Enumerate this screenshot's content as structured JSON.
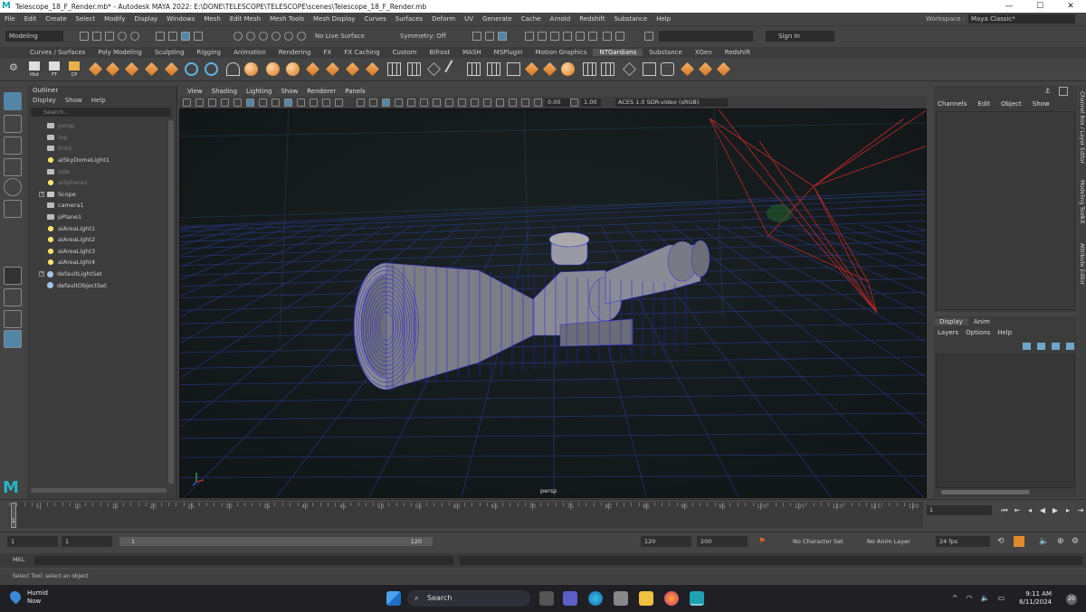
{
  "window": {
    "title": "Telescope_18_F_Render.mb* - Autodesk MAYA 2022: E:\\DONE\\TELESCOPE\\TELESCOPE\\scenes\\Telescope_18_F_Render.mb",
    "buttons": [
      "—",
      "☐",
      "✕"
    ]
  },
  "menubar": {
    "items": [
      "File",
      "Edit",
      "Create",
      "Select",
      "Modify",
      "Display",
      "Windows",
      "Mesh",
      "Edit Mesh",
      "Mesh Tools",
      "Mesh Display",
      "Curves",
      "Surfaces",
      "Deform",
      "UV",
      "Generate",
      "Cache",
      "Arnold",
      "Redshift",
      "Substance",
      "Help"
    ],
    "workspace_label": "Workspace :",
    "workspace_value": "Maya Classic*"
  },
  "statusline": {
    "mode": "Modeling",
    "live_surface": "No Live Surface",
    "symmetry": "Symmetry: Off",
    "sign_in": "Sign In"
  },
  "shelf": {
    "tabs": [
      "Curves / Surfaces",
      "Poly Modeling",
      "Sculpting",
      "Rigging",
      "Animation",
      "Rendering",
      "FX",
      "FX Caching",
      "Custom",
      "Bifrost",
      "MASH",
      "MSPlugin",
      "Motion Graphics",
      "NTGardians",
      "Substance",
      "XGen",
      "Redshift"
    ],
    "active_tab": "NTGardians",
    "small_labels": [
      "Hist",
      "FT",
      "CP"
    ]
  },
  "outliner": {
    "title": "Outliner",
    "menu": [
      "Display",
      "Show",
      "Help"
    ],
    "search_placeholder": "Search...",
    "items": [
      {
        "label": "persp",
        "icon": "camera-icon",
        "dim": true
      },
      {
        "label": "top",
        "icon": "camera-icon",
        "dim": true
      },
      {
        "label": "front",
        "icon": "camera-icon",
        "dim": true
      },
      {
        "label": "aiSkyDomeLight1",
        "icon": "light-icon",
        "dim": false
      },
      {
        "label": "side",
        "icon": "camera-icon",
        "dim": true
      },
      {
        "label": "aiSphere1",
        "icon": "light-icon",
        "dim": true
      },
      {
        "label": "Scope",
        "icon": "group-icon",
        "dim": false,
        "expandable": true
      },
      {
        "label": "camera1",
        "icon": "camera-icon",
        "dim": false
      },
      {
        "label": "pPlane1",
        "icon": "mesh-icon",
        "dim": false
      },
      {
        "label": "aiAreaLight1",
        "icon": "light-icon",
        "dim": false
      },
      {
        "label": "aiAreaLight2",
        "icon": "light-icon",
        "dim": false
      },
      {
        "label": "aiAreaLight3",
        "icon": "light-icon",
        "dim": false
      },
      {
        "label": "aiAreaLight4",
        "icon": "light-icon",
        "dim": false
      },
      {
        "label": "defaultLightSet",
        "icon": "set-icon",
        "dim": false,
        "expandable": true
      },
      {
        "label": "defaultObjectSet",
        "icon": "set-icon",
        "dim": false
      }
    ]
  },
  "viewport": {
    "menu": [
      "View",
      "Shading",
      "Lighting",
      "Show",
      "Renderer",
      "Panels"
    ],
    "exposure": "0.00",
    "gamma": "1.00",
    "color_space": "ACES 1.0 SDR-video (sRGB)",
    "camera_label": "persp"
  },
  "channelbox": {
    "menu": [
      "Channels",
      "Edit",
      "Object",
      "Show"
    ]
  },
  "layers": {
    "tabs": [
      "Display",
      "Anim"
    ],
    "menu": [
      "Layers",
      "Options",
      "Help"
    ]
  },
  "sidetabs": [
    "Channel Box / Layer Editor",
    "Modeling Toolkit",
    "Attribute Editor"
  ],
  "timeslider": {
    "ticks": [
      "5",
      "10",
      "15",
      "20",
      "25",
      "30",
      "35",
      "40",
      "45",
      "50",
      "55",
      "60",
      "65",
      "70",
      "75",
      "80",
      "85",
      "90",
      "95",
      "100",
      "105",
      "110",
      "115",
      "120"
    ],
    "current_frame": "1",
    "frame_field": "1"
  },
  "rangeslider": {
    "start": "1",
    "playback_start": "1",
    "bar_start": "1",
    "bar_end": "120",
    "playback_end": "120",
    "end": "200",
    "character_set": "No Character Set",
    "anim_layer": "No Anim Layer",
    "fps": "24 fps"
  },
  "cmdline": {
    "label": "MEL",
    "help": "Select Tool: select an object"
  },
  "taskbar": {
    "weather_title": "Humid",
    "weather_sub": "Now",
    "search": "Search",
    "time": "9:11 AM",
    "date": "6/11/2024",
    "notifications": "20"
  },
  "colors": {
    "accent": "#5285a6",
    "wire": "#2a2aa8",
    "light_wire": "#c0282a",
    "ground_grid": "#1c2a7a"
  }
}
